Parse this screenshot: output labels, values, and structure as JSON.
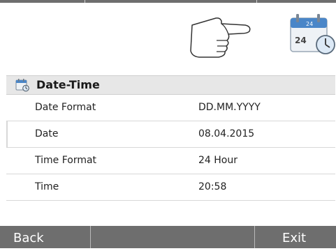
{
  "panel": {
    "title": "Date-Time",
    "rows": [
      {
        "label": "Date Format",
        "value": "DD.MM.YYYY"
      },
      {
        "label": "Date",
        "value": "08.04.2015"
      },
      {
        "label": "Time Format",
        "value": "24 Hour"
      },
      {
        "label": "Time",
        "value": "20:58"
      }
    ]
  },
  "app_icon": {
    "calendar_number": "24",
    "small_text": "24",
    "icon": "calendar-clock-icon"
  },
  "bottom_bar": {
    "back_label": "Back",
    "middle_label": "",
    "exit_label": "Exit"
  },
  "colors": {
    "bar_gray": "#6e6e6e",
    "header_gray": "#e7e7e7",
    "calendar_blue": "#4a86c8"
  }
}
